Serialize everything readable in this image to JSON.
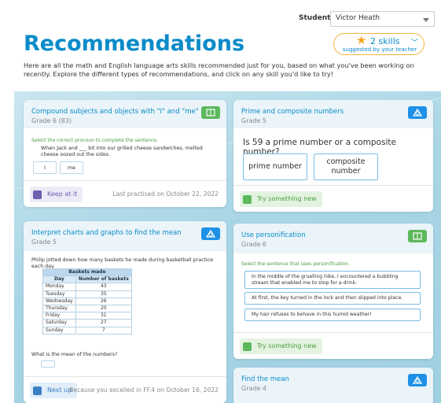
{
  "header": {
    "student_label": "Student",
    "student_value": "Victor Heath",
    "title": "Recommendations",
    "skills_count": "2 skills",
    "skills_sub": "suggested by your teacher",
    "intro": "Here are all the math and English language arts skills recommended just for you, based on what you've been working on recently. Explore the different types of recommendations, and click on any skill you'd like to try!"
  },
  "colors": {
    "accent": "#0a8bc9",
    "green": "#5cb85c",
    "blue": "#1e90e6",
    "purple": "#6c5fb0",
    "star": "#f5a623"
  },
  "cards": {
    "compound": {
      "title": "Compound subjects and objects with \"I\" and \"me\"",
      "grade": "Grade 6 (83)",
      "instruction": "Select the correct pronoun to complete the sentence.",
      "sentence": "When Jack and ___ bit into our grilled cheese sandwiches, melted cheese oozed out the sides.",
      "option1": "I",
      "option2": "me",
      "action": "Keep at it",
      "note": "Last practised on October 22, 2022",
      "icon": "book-icon"
    },
    "prime": {
      "title": "Prime and composite numbers",
      "grade": "Grade 5",
      "question": "Is 59 a prime number or a composite number?",
      "option1": "prime number",
      "option2_line1": "composite",
      "option2_line2": "number",
      "action": "Try something new",
      "icon": "shapes-icon"
    },
    "charts": {
      "title": "Interpret charts and graphs to find the mean",
      "grade": "Grade 5",
      "prompt": "Philip jotted down how many baskets he made during basketball practice each day.",
      "table_caption": "Baskets made",
      "col_day": "Day",
      "col_baskets": "Number of baskets",
      "rows": [
        {
          "day": "Monday",
          "value": "43"
        },
        {
          "day": "Tuesday",
          "value": "35"
        },
        {
          "day": "Wednesday",
          "value": "26"
        },
        {
          "day": "Thursday",
          "value": "20"
        },
        {
          "day": "Friday",
          "value": "31"
        },
        {
          "day": "Saturday",
          "value": "27"
        },
        {
          "day": "Sunday",
          "value": "7"
        }
      ],
      "question": "What is the mean of the numbers?",
      "action": "Next up",
      "note": "Because you excelled in FF.4 on October 16, 2022",
      "icon": "shapes-icon"
    },
    "personification": {
      "title": "Use personification",
      "grade": "Grade 6",
      "instruction": "Select the sentence that uses personification.",
      "s1": "In the middle of the gruelling hike, I encountered a bubbling stream that enabled me to stop for a drink.",
      "s2": "At first, the key turned in the lock and then slipped into place.",
      "s3": "My hair refuses to behave in this humid weather!",
      "action": "Try something new",
      "icon": "book-icon"
    },
    "mean": {
      "title": "Find the mean",
      "grade": "Grade 4",
      "icon": "shapes-icon"
    }
  }
}
